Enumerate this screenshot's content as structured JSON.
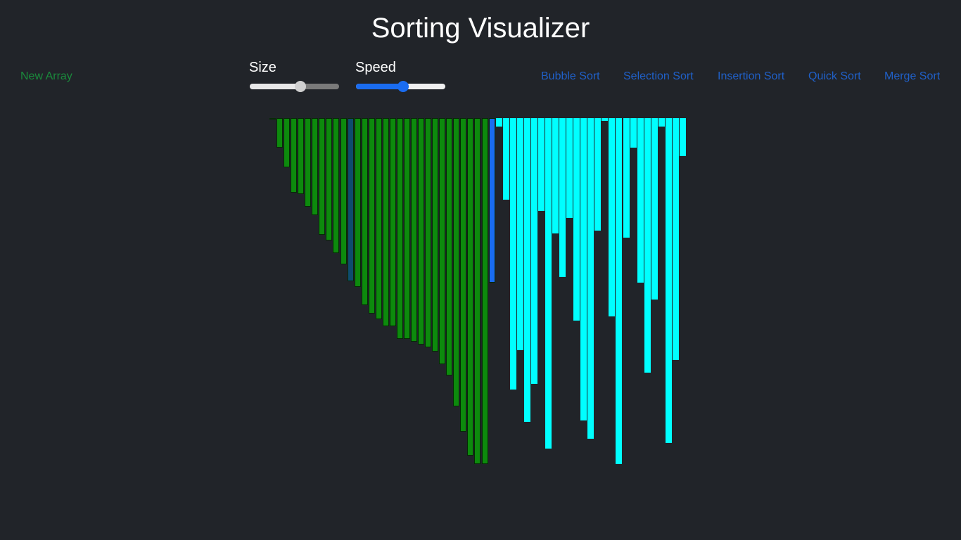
{
  "header": {
    "title": "Sorting Visualizer"
  },
  "controls": {
    "new_array_label": "New Array",
    "size_label": "Size",
    "size_value": 0.57,
    "speed_label": "Speed",
    "speed_value": 0.53
  },
  "algorithms": [
    "Bubble Sort",
    "Selection Sort",
    "Insertion Sort",
    "Quick Sort",
    "Merge Sort"
  ],
  "colors": {
    "sorted": "#0d8a0d",
    "sorted_border": "#062a06",
    "unsorted": "#00ffff",
    "compare": "#1a6cf0",
    "marker": "#0e4c6e",
    "background": "#212429"
  },
  "chart_data": {
    "type": "bar",
    "values": [
      2,
      42,
      70,
      106,
      108,
      126,
      138,
      166,
      174,
      192,
      208,
      232,
      240,
      266,
      278,
      286,
      296,
      296,
      314,
      314,
      318,
      322,
      326,
      332,
      350,
      366,
      410,
      446,
      480,
      492,
      492,
      234,
      12,
      116,
      386,
      330,
      432,
      378,
      132,
      470,
      164,
      226,
      142,
      288,
      430,
      456,
      160,
      4,
      282,
      492,
      170,
      42,
      234,
      362,
      258,
      12,
      462,
      344,
      54
    ],
    "states": [
      "sorted",
      "sorted",
      "sorted",
      "sorted",
      "sorted",
      "sorted",
      "sorted",
      "sorted",
      "sorted",
      "sorted",
      "sorted",
      "marker",
      "sorted",
      "sorted",
      "sorted",
      "sorted",
      "sorted",
      "sorted",
      "sorted",
      "sorted",
      "sorted",
      "sorted",
      "sorted",
      "sorted",
      "sorted",
      "sorted",
      "sorted",
      "sorted",
      "sorted",
      "sorted",
      "sorted",
      "compare",
      "unsorted",
      "unsorted",
      "unsorted",
      "unsorted",
      "unsorted",
      "unsorted",
      "unsorted",
      "unsorted",
      "unsorted",
      "unsorted",
      "unsorted",
      "unsorted",
      "unsorted",
      "unsorted",
      "unsorted",
      "unsorted",
      "unsorted",
      "unsorted",
      "unsorted",
      "unsorted",
      "unsorted",
      "unsorted",
      "unsorted",
      "unsorted",
      "unsorted",
      "unsorted",
      "unsorted"
    ]
  }
}
